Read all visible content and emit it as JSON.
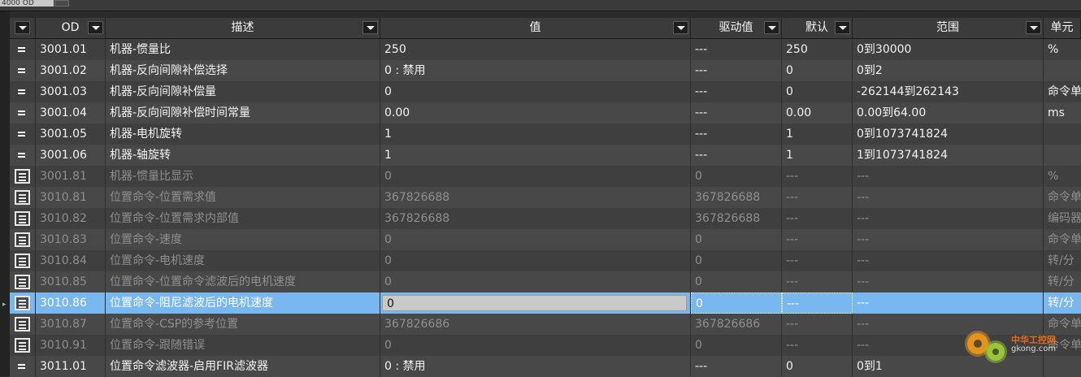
{
  "top": {
    "tab_label": "4000 OD"
  },
  "columns": {
    "od": "OD",
    "desc": "描述",
    "value": "值",
    "drive": "驱动值",
    "default": "默认",
    "range": "范围",
    "unit": "单元"
  },
  "rows": [
    {
      "icon": "equals",
      "editable": true,
      "od": "3001.01",
      "desc": "机器-惯量比",
      "value": "250",
      "drive": "---",
      "default": "250",
      "range": "0到30000",
      "unit": "%"
    },
    {
      "icon": "equals",
      "editable": true,
      "od": "3001.02",
      "desc": "机器-反向间隙补偿选择",
      "value": "0 : 禁用",
      "drive": "---",
      "default": "0",
      "range": "0到2",
      "unit": ""
    },
    {
      "icon": "equals",
      "editable": true,
      "od": "3001.03",
      "desc": "机器-反向间隙补偿量",
      "value": "0",
      "drive": "---",
      "default": "0",
      "range": "-262144到262143",
      "unit": "命令单"
    },
    {
      "icon": "equals",
      "editable": true,
      "od": "3001.04",
      "desc": "机器-反向间隙补偿时间常量",
      "value": "0.00",
      "drive": "---",
      "default": "0.00",
      "range": "0.00到64.00",
      "unit": "ms"
    },
    {
      "icon": "equals",
      "editable": true,
      "od": "3001.05",
      "desc": "机器-电机旋转",
      "value": "1",
      "drive": "---",
      "default": "1",
      "range": "0到1073741824",
      "unit": ""
    },
    {
      "icon": "equals",
      "editable": true,
      "od": "3001.06",
      "desc": "机器-轴旋转",
      "value": "1",
      "drive": "---",
      "default": "1",
      "range": "1到1073741824",
      "unit": ""
    },
    {
      "icon": "list",
      "editable": false,
      "od": "3001.81",
      "desc": "机器-惯量比显示",
      "value": "0",
      "drive": "0",
      "default": "---",
      "range": "---",
      "unit": "%"
    },
    {
      "icon": "list",
      "editable": false,
      "od": "3010.81",
      "desc": "位置命令-位置需求值",
      "value": "367826688",
      "drive": "367826688",
      "default": "---",
      "range": "---",
      "unit": "命令单"
    },
    {
      "icon": "list",
      "editable": false,
      "od": "3010.82",
      "desc": "位置命令-位置需求内部值",
      "value": "367826688",
      "drive": "367826688",
      "default": "---",
      "range": "---",
      "unit": "编码器"
    },
    {
      "icon": "list",
      "editable": false,
      "od": "3010.83",
      "desc": "位置命令-速度",
      "value": "0",
      "drive": "0",
      "default": "---",
      "range": "---",
      "unit": "命令单"
    },
    {
      "icon": "list",
      "editable": false,
      "od": "3010.84",
      "desc": "位置命令-电机速度",
      "value": "0",
      "drive": "0",
      "default": "---",
      "range": "---",
      "unit": "转/分"
    },
    {
      "icon": "list",
      "editable": false,
      "od": "3010.85",
      "desc": "位置命令-位置命令滤波后的电机速度",
      "value": "0",
      "drive": "0",
      "default": "---",
      "range": "---",
      "unit": "转/分"
    },
    {
      "icon": "list",
      "editable": false,
      "selected": true,
      "od": "3010.86",
      "desc": "位置命令-阻尼滤波后的电机速度",
      "value": "0",
      "drive": "0",
      "default": "---",
      "range": "---",
      "unit": "转/分"
    },
    {
      "icon": "list",
      "editable": false,
      "od": "3010.87",
      "desc": "位置命令-CSP的参考位置",
      "value": "367826686",
      "drive": "367826686",
      "default": "---",
      "range": "---",
      "unit": "命令单"
    },
    {
      "icon": "list",
      "editable": false,
      "od": "3010.91",
      "desc": "位置命令-跟随错误",
      "value": "0",
      "drive": "0",
      "default": "---",
      "range": "---",
      "unit": "命令单"
    },
    {
      "icon": "equals",
      "editable": true,
      "od": "3011.01",
      "desc": "位置命令滤波器-启用FIR滤波器",
      "value": "0 : 禁用",
      "drive": "---",
      "default": "0",
      "range": "0到1",
      "unit": ""
    }
  ],
  "watermark": {
    "line1": "中华工控网",
    "line2": "gkong.com"
  },
  "colors": {
    "selected_row": "#78b7f0",
    "readonly_text": "#8f8f8f",
    "row_odd": "#3f3f3f",
    "row_even": "#484848"
  }
}
